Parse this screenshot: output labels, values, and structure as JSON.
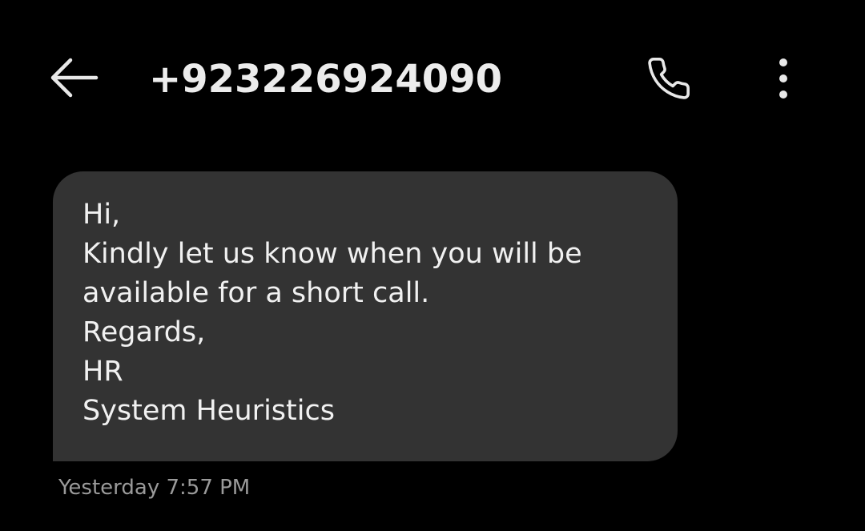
{
  "header": {
    "back_icon": "arrow-left-icon",
    "title": "+923226924090",
    "call_icon": "phone-icon",
    "more_icon": "more-vertical-icon"
  },
  "message": {
    "lines": [
      "Hi,",
      "Kindly let us know when you will be",
      "available for a short call.",
      "Regards,",
      "HR",
      "System Heuristics"
    ],
    "timestamp": "Yesterday 7:57 PM"
  },
  "colors": {
    "background": "#000000",
    "bubble": "#333333",
    "text": "#ececec",
    "timestamp": "#9a9a9a"
  }
}
